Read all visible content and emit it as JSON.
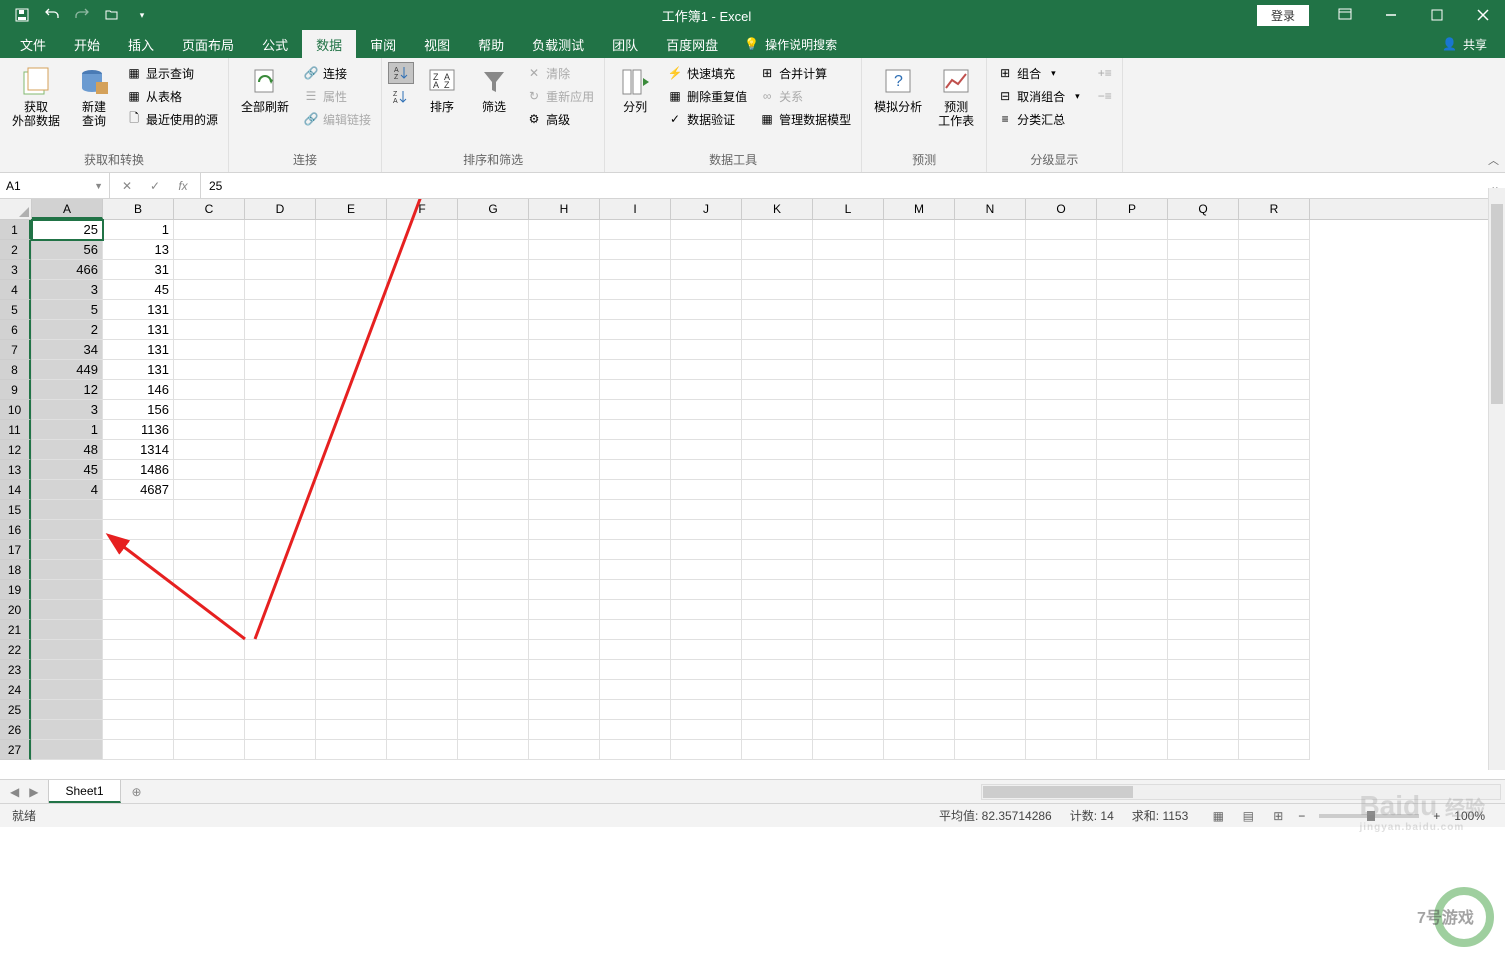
{
  "app": {
    "title": "工作簿1 - Excel",
    "login": "登录",
    "share": "共享"
  },
  "tabs": [
    "文件",
    "开始",
    "插入",
    "页面布局",
    "公式",
    "数据",
    "审阅",
    "视图",
    "帮助",
    "负载测试",
    "团队",
    "百度网盘"
  ],
  "active_tab": 5,
  "tell_me": "操作说明搜索",
  "ribbon": {
    "g1": {
      "label": "获取和转换",
      "btn1": "获取\n外部数据",
      "btn2": "新建\n查询",
      "s1": "显示查询",
      "s2": "从表格",
      "s3": "最近使用的源"
    },
    "g2": {
      "label": "连接",
      "btn": "全部刷新",
      "s1": "连接",
      "s2": "属性",
      "s3": "编辑链接"
    },
    "g3": {
      "label": "排序和筛选",
      "btn1": "排序",
      "btn2": "筛选",
      "s1": "清除",
      "s2": "重新应用",
      "s3": "高级"
    },
    "g4": {
      "label": "数据工具",
      "btn": "分列",
      "s1": "快速填充",
      "s2": "删除重复值",
      "s3": "数据验证",
      "s4": "合并计算",
      "s5": "关系",
      "s6": "管理数据模型"
    },
    "g5": {
      "label": "预测",
      "btn1": "模拟分析",
      "btn2": "预测\n工作表"
    },
    "g6": {
      "label": "分级显示",
      "s1": "组合",
      "s2": "取消组合",
      "s3": "分类汇总"
    }
  },
  "formula": {
    "name": "A1",
    "value": "25",
    "fx": "fx"
  },
  "columns": [
    "A",
    "B",
    "C",
    "D",
    "E",
    "F",
    "G",
    "H",
    "I",
    "J",
    "K",
    "L",
    "M",
    "N",
    "O",
    "P",
    "Q",
    "R"
  ],
  "rows": 27,
  "selected_col": 0,
  "data_a": [
    "25",
    "56",
    "466",
    "3",
    "5",
    "2",
    "34",
    "449",
    "12",
    "3",
    "1",
    "48",
    "45",
    "4"
  ],
  "data_b": [
    "1",
    "13",
    "31",
    "45",
    "131",
    "131",
    "131",
    "131",
    "146",
    "156",
    "1136",
    "1314",
    "1486",
    "4687"
  ],
  "sheet": {
    "name": "Sheet1"
  },
  "status": {
    "ready": "就绪",
    "avg_label": "平均值:",
    "avg": "82.35714286",
    "count_label": "计数:",
    "count": "14",
    "sum_label": "求和:",
    "sum": "1153",
    "zoom": "100%"
  },
  "watermark": {
    "brand": "Baidu",
    "sub": "jingyan.baidu.com",
    "tag": "经验"
  }
}
